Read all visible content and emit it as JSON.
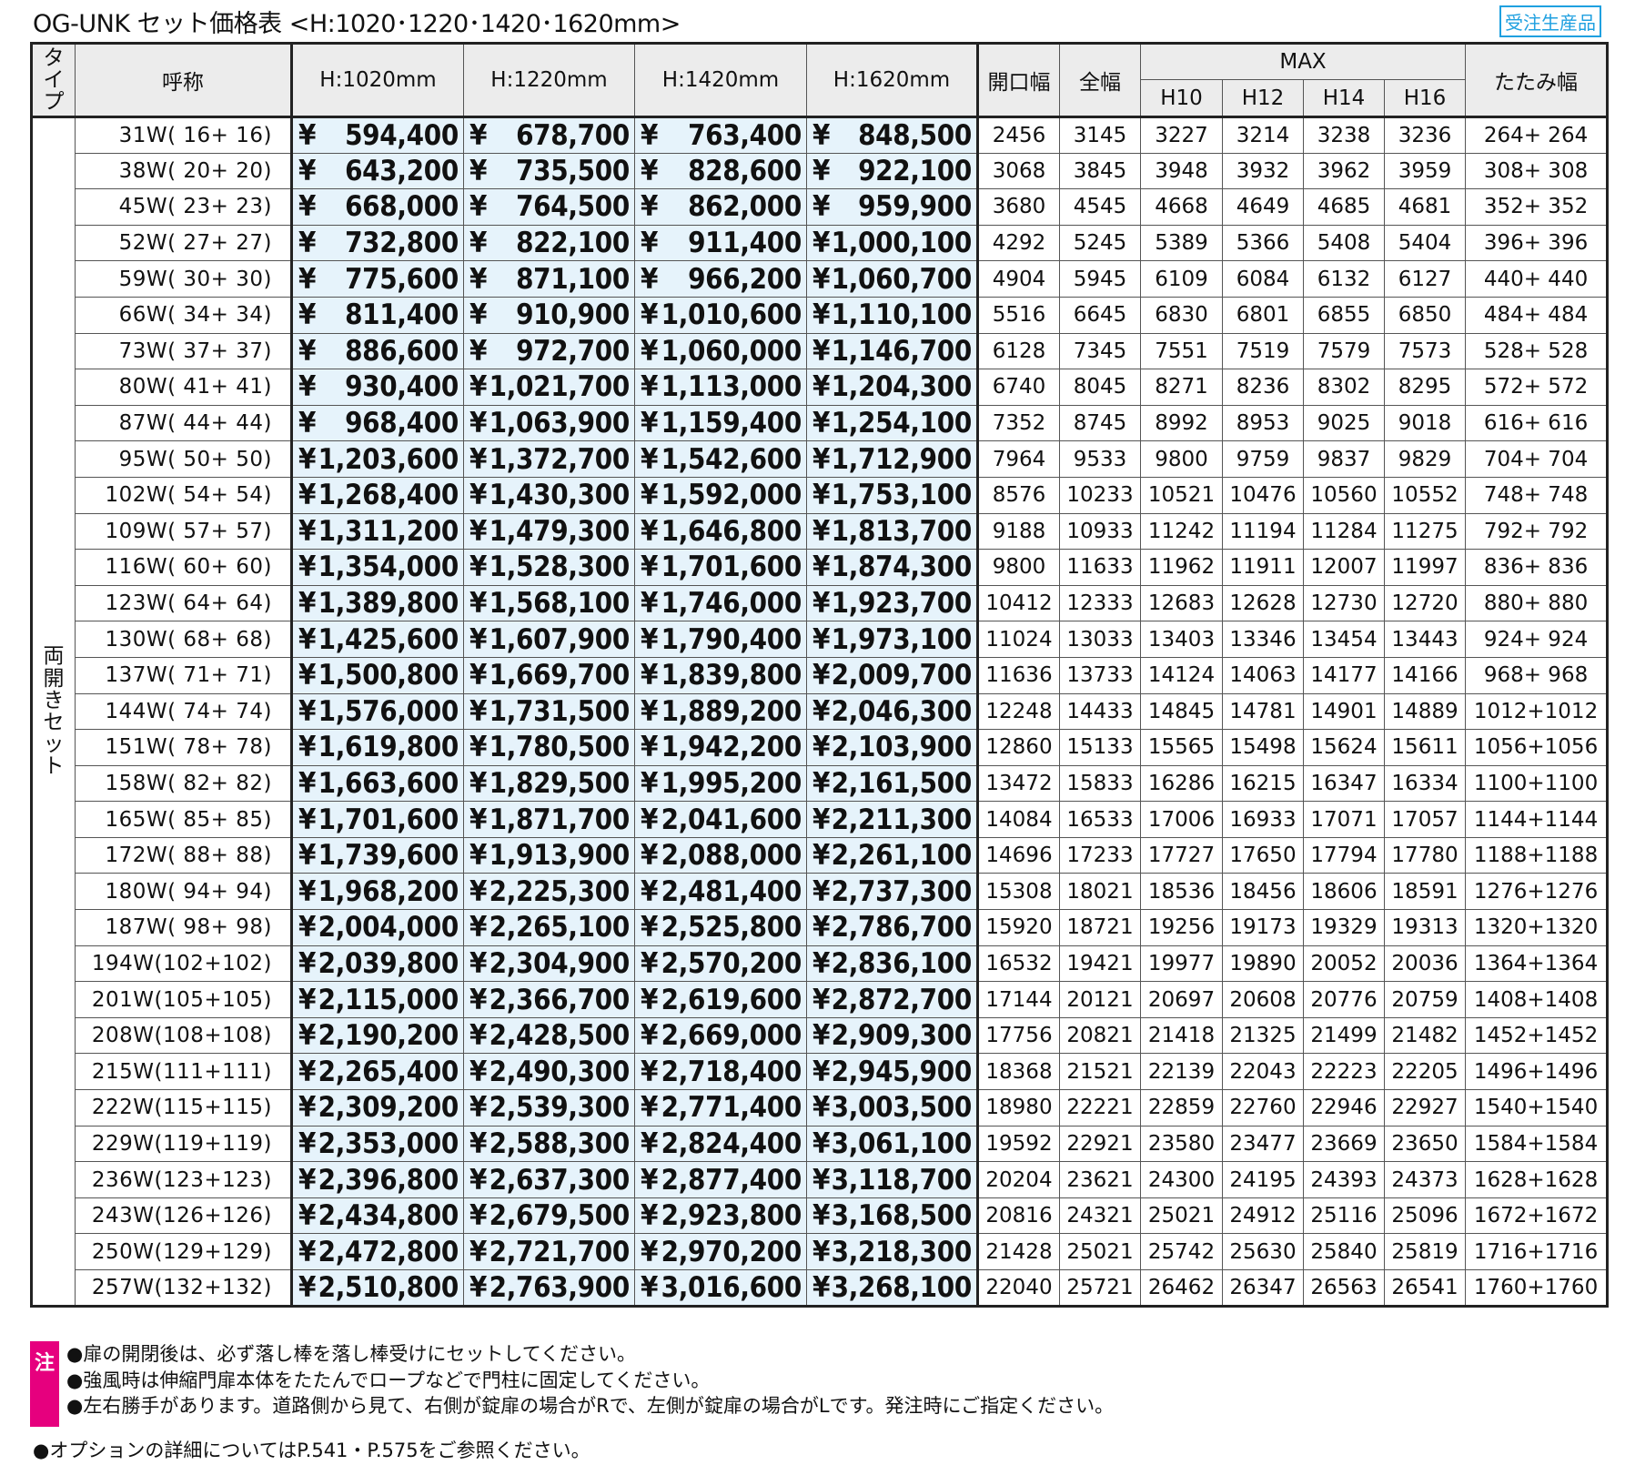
{
  "title": "OG-UNK セット価格表 <H:1020･1220･1420･1620mm>",
  "badge": "受注生産品",
  "header": {
    "type_chars": [
      "タ",
      "イ",
      "プ"
    ],
    "name": "呼称",
    "h1020": "H:1020mm",
    "h1220": "H:1220mm",
    "h1420": "H:1420mm",
    "h1620": "H:1620mm",
    "opening": "開口幅",
    "total": "全幅",
    "max": "MAX",
    "h10": "H10",
    "h12": "H12",
    "h14": "H14",
    "h16": "H16",
    "fold": "たたみ幅"
  },
  "type_chars": [
    "両",
    "開",
    "き",
    "セ",
    "ッ",
    "ト"
  ],
  "currency": "¥",
  "rows": [
    {
      "name": "31W( 16+ 16)",
      "p": [
        "594,400",
        "678,700",
        "763,400",
        "848,500"
      ],
      "open": "2456",
      "total": "3145",
      "max": [
        "3227",
        "3214",
        "3238",
        "3236"
      ],
      "fold": "264+ 264"
    },
    {
      "name": "38W( 20+ 20)",
      "p": [
        "643,200",
        "735,500",
        "828,600",
        "922,100"
      ],
      "open": "3068",
      "total": "3845",
      "max": [
        "3948",
        "3932",
        "3962",
        "3959"
      ],
      "fold": "308+ 308"
    },
    {
      "name": "45W( 23+ 23)",
      "p": [
        "668,000",
        "764,500",
        "862,000",
        "959,900"
      ],
      "open": "3680",
      "total": "4545",
      "max": [
        "4668",
        "4649",
        "4685",
        "4681"
      ],
      "fold": "352+ 352"
    },
    {
      "name": "52W( 27+ 27)",
      "p": [
        "732,800",
        "822,100",
        "911,400",
        "1,000,100"
      ],
      "open": "4292",
      "total": "5245",
      "max": [
        "5389",
        "5366",
        "5408",
        "5404"
      ],
      "fold": "396+ 396"
    },
    {
      "name": "59W( 30+ 30)",
      "p": [
        "775,600",
        "871,100",
        "966,200",
        "1,060,700"
      ],
      "open": "4904",
      "total": "5945",
      "max": [
        "6109",
        "6084",
        "6132",
        "6127"
      ],
      "fold": "440+ 440"
    },
    {
      "name": "66W( 34+ 34)",
      "p": [
        "811,400",
        "910,900",
        "1,010,600",
        "1,110,100"
      ],
      "open": "5516",
      "total": "6645",
      "max": [
        "6830",
        "6801",
        "6855",
        "6850"
      ],
      "fold": "484+ 484"
    },
    {
      "name": "73W( 37+ 37)",
      "p": [
        "886,600",
        "972,700",
        "1,060,000",
        "1,146,700"
      ],
      "open": "6128",
      "total": "7345",
      "max": [
        "7551",
        "7519",
        "7579",
        "7573"
      ],
      "fold": "528+ 528"
    },
    {
      "name": "80W( 41+ 41)",
      "p": [
        "930,400",
        "1,021,700",
        "1,113,000",
        "1,204,300"
      ],
      "open": "6740",
      "total": "8045",
      "max": [
        "8271",
        "8236",
        "8302",
        "8295"
      ],
      "fold": "572+ 572"
    },
    {
      "name": "87W( 44+ 44)",
      "p": [
        "968,400",
        "1,063,900",
        "1,159,400",
        "1,254,100"
      ],
      "open": "7352",
      "total": "8745",
      "max": [
        "8992",
        "8953",
        "9025",
        "9018"
      ],
      "fold": "616+ 616"
    },
    {
      "name": "95W( 50+ 50)",
      "p": [
        "1,203,600",
        "1,372,700",
        "1,542,600",
        "1,712,900"
      ],
      "open": "7964",
      "total": "9533",
      "max": [
        "9800",
        "9759",
        "9837",
        "9829"
      ],
      "fold": "704+ 704"
    },
    {
      "name": "102W( 54+ 54)",
      "p": [
        "1,268,400",
        "1,430,300",
        "1,592,000",
        "1,753,100"
      ],
      "open": "8576",
      "total": "10233",
      "max": [
        "10521",
        "10476",
        "10560",
        "10552"
      ],
      "fold": "748+ 748"
    },
    {
      "name": "109W( 57+ 57)",
      "p": [
        "1,311,200",
        "1,479,300",
        "1,646,800",
        "1,813,700"
      ],
      "open": "9188",
      "total": "10933",
      "max": [
        "11242",
        "11194",
        "11284",
        "11275"
      ],
      "fold": "792+ 792"
    },
    {
      "name": "116W( 60+ 60)",
      "p": [
        "1,354,000",
        "1,528,300",
        "1,701,600",
        "1,874,300"
      ],
      "open": "9800",
      "total": "11633",
      "max": [
        "11962",
        "11911",
        "12007",
        "11997"
      ],
      "fold": "836+ 836"
    },
    {
      "name": "123W( 64+ 64)",
      "p": [
        "1,389,800",
        "1,568,100",
        "1,746,000",
        "1,923,700"
      ],
      "open": "10412",
      "total": "12333",
      "max": [
        "12683",
        "12628",
        "12730",
        "12720"
      ],
      "fold": "880+ 880"
    },
    {
      "name": "130W( 68+ 68)",
      "p": [
        "1,425,600",
        "1,607,900",
        "1,790,400",
        "1,973,100"
      ],
      "open": "11024",
      "total": "13033",
      "max": [
        "13403",
        "13346",
        "13454",
        "13443"
      ],
      "fold": "924+ 924"
    },
    {
      "name": "137W( 71+ 71)",
      "p": [
        "1,500,800",
        "1,669,700",
        "1,839,800",
        "2,009,700"
      ],
      "open": "11636",
      "total": "13733",
      "max": [
        "14124",
        "14063",
        "14177",
        "14166"
      ],
      "fold": "968+ 968"
    },
    {
      "name": "144W( 74+ 74)",
      "p": [
        "1,576,000",
        "1,731,500",
        "1,889,200",
        "2,046,300"
      ],
      "open": "12248",
      "total": "14433",
      "max": [
        "14845",
        "14781",
        "14901",
        "14889"
      ],
      "fold": "1012+1012"
    },
    {
      "name": "151W( 78+ 78)",
      "p": [
        "1,619,800",
        "1,780,500",
        "1,942,200",
        "2,103,900"
      ],
      "open": "12860",
      "total": "15133",
      "max": [
        "15565",
        "15498",
        "15624",
        "15611"
      ],
      "fold": "1056+1056"
    },
    {
      "name": "158W( 82+ 82)",
      "p": [
        "1,663,600",
        "1,829,500",
        "1,995,200",
        "2,161,500"
      ],
      "open": "13472",
      "total": "15833",
      "max": [
        "16286",
        "16215",
        "16347",
        "16334"
      ],
      "fold": "1100+1100"
    },
    {
      "name": "165W( 85+ 85)",
      "p": [
        "1,701,600",
        "1,871,700",
        "2,041,600",
        "2,211,300"
      ],
      "open": "14084",
      "total": "16533",
      "max": [
        "17006",
        "16933",
        "17071",
        "17057"
      ],
      "fold": "1144+1144"
    },
    {
      "name": "172W( 88+ 88)",
      "p": [
        "1,739,600",
        "1,913,900",
        "2,088,000",
        "2,261,100"
      ],
      "open": "14696",
      "total": "17233",
      "max": [
        "17727",
        "17650",
        "17794",
        "17780"
      ],
      "fold": "1188+1188"
    },
    {
      "name": "180W( 94+ 94)",
      "p": [
        "1,968,200",
        "2,225,300",
        "2,481,400",
        "2,737,300"
      ],
      "open": "15308",
      "total": "18021",
      "max": [
        "18536",
        "18456",
        "18606",
        "18591"
      ],
      "fold": "1276+1276"
    },
    {
      "name": "187W( 98+ 98)",
      "p": [
        "2,004,000",
        "2,265,100",
        "2,525,800",
        "2,786,700"
      ],
      "open": "15920",
      "total": "18721",
      "max": [
        "19256",
        "19173",
        "19329",
        "19313"
      ],
      "fold": "1320+1320"
    },
    {
      "name": "194W(102+102)",
      "p": [
        "2,039,800",
        "2,304,900",
        "2,570,200",
        "2,836,100"
      ],
      "open": "16532",
      "total": "19421",
      "max": [
        "19977",
        "19890",
        "20052",
        "20036"
      ],
      "fold": "1364+1364"
    },
    {
      "name": "201W(105+105)",
      "p": [
        "2,115,000",
        "2,366,700",
        "2,619,600",
        "2,872,700"
      ],
      "open": "17144",
      "total": "20121",
      "max": [
        "20697",
        "20608",
        "20776",
        "20759"
      ],
      "fold": "1408+1408"
    },
    {
      "name": "208W(108+108)",
      "p": [
        "2,190,200",
        "2,428,500",
        "2,669,000",
        "2,909,300"
      ],
      "open": "17756",
      "total": "20821",
      "max": [
        "21418",
        "21325",
        "21499",
        "21482"
      ],
      "fold": "1452+1452"
    },
    {
      "name": "215W(111+111)",
      "p": [
        "2,265,400",
        "2,490,300",
        "2,718,400",
        "2,945,900"
      ],
      "open": "18368",
      "total": "21521",
      "max": [
        "22139",
        "22043",
        "22223",
        "22205"
      ],
      "fold": "1496+1496"
    },
    {
      "name": "222W(115+115)",
      "p": [
        "2,309,200",
        "2,539,300",
        "2,771,400",
        "3,003,500"
      ],
      "open": "18980",
      "total": "22221",
      "max": [
        "22859",
        "22760",
        "22946",
        "22927"
      ],
      "fold": "1540+1540"
    },
    {
      "name": "229W(119+119)",
      "p": [
        "2,353,000",
        "2,588,300",
        "2,824,400",
        "3,061,100"
      ],
      "open": "19592",
      "total": "22921",
      "max": [
        "23580",
        "23477",
        "23669",
        "23650"
      ],
      "fold": "1584+1584"
    },
    {
      "name": "236W(123+123)",
      "p": [
        "2,396,800",
        "2,637,300",
        "2,877,400",
        "3,118,700"
      ],
      "open": "20204",
      "total": "23621",
      "max": [
        "24300",
        "24195",
        "24393",
        "24373"
      ],
      "fold": "1628+1628"
    },
    {
      "name": "243W(126+126)",
      "p": [
        "2,434,800",
        "2,679,500",
        "2,923,800",
        "3,168,500"
      ],
      "open": "20816",
      "total": "24321",
      "max": [
        "25021",
        "24912",
        "25116",
        "25096"
      ],
      "fold": "1672+1672"
    },
    {
      "name": "250W(129+129)",
      "p": [
        "2,472,800",
        "2,721,700",
        "2,970,200",
        "3,218,300"
      ],
      "open": "21428",
      "total": "25021",
      "max": [
        "25742",
        "25630",
        "25840",
        "25819"
      ],
      "fold": "1716+1716"
    },
    {
      "name": "257W(132+132)",
      "p": [
        "2,510,800",
        "2,763,900",
        "3,016,600",
        "3,268,100"
      ],
      "open": "22040",
      "total": "25721",
      "max": [
        "26462",
        "26347",
        "26563",
        "26541"
      ],
      "fold": "1760+1760"
    }
  ],
  "notes": {
    "mark": "注",
    "lines": [
      "●扉の開閉後は、必ず落し棒を落し棒受けにセットしてください。",
      "●強風時は伸縮門扉本体をたたんでロープなどで門柱に固定してください。",
      "●左右勝手があります。道路側から見て、右側が錠扉の場合がRで、左側が錠扉の場合がLです。発注時にご指定ください。"
    ]
  },
  "option_note": "●オプションの詳細についてはP.541・P.575をご参照ください。",
  "colors": {
    "price_bg": "#e6f3fb",
    "header_bg": "#ececec",
    "note_mark": "#e6007e",
    "badge": "#1fa0e0"
  }
}
